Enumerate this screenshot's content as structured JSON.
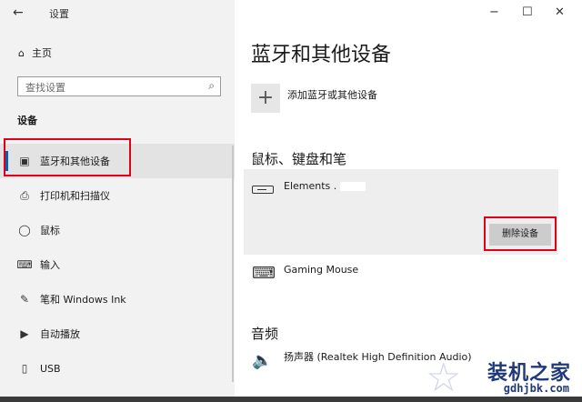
{
  "window": {
    "title": "设置",
    "back_glyph": "←",
    "minimize_glyph": "−",
    "maximize_glyph": "☐",
    "close_glyph": "✕"
  },
  "sidebar": {
    "home_label": "主页",
    "search_placeholder": "查找设置",
    "section_label": "设备",
    "items": [
      {
        "label": "蓝牙和其他设备",
        "icon": "bluetooth-devices-icon",
        "active": true
      },
      {
        "label": "打印机和扫描仪",
        "icon": "printer-icon",
        "active": false
      },
      {
        "label": "鼠标",
        "icon": "mouse-icon",
        "active": false
      },
      {
        "label": "输入",
        "icon": "keyboard-icon",
        "active": false
      },
      {
        "label": "笔和 Windows Ink",
        "icon": "pen-icon",
        "active": false
      },
      {
        "label": "自动播放",
        "icon": "autoplay-icon",
        "active": false
      },
      {
        "label": "USB",
        "icon": "usb-icon",
        "active": false
      }
    ]
  },
  "main": {
    "title": "蓝牙和其他设备",
    "add_device_label": "添加蓝牙或其他设备",
    "mouse_section_heading": "鼠标、键盘和笔",
    "devices": [
      {
        "name": "Elements .",
        "icon": "keyboard-icon"
      },
      {
        "name": "Gaming Mouse",
        "icon": "keyboard-icon"
      }
    ],
    "remove_button_label": "删除设备",
    "audio_section_heading": "音频",
    "audio_device_name": "扬声器 (Realtek High Definition Audio)"
  },
  "watermark": {
    "text": "装机之家",
    "url": "gdhjbk.com"
  },
  "colors": {
    "sidebar_bg": "#f2f2f2",
    "accent": "#0063b1",
    "highlight_box": "#e0001b"
  }
}
